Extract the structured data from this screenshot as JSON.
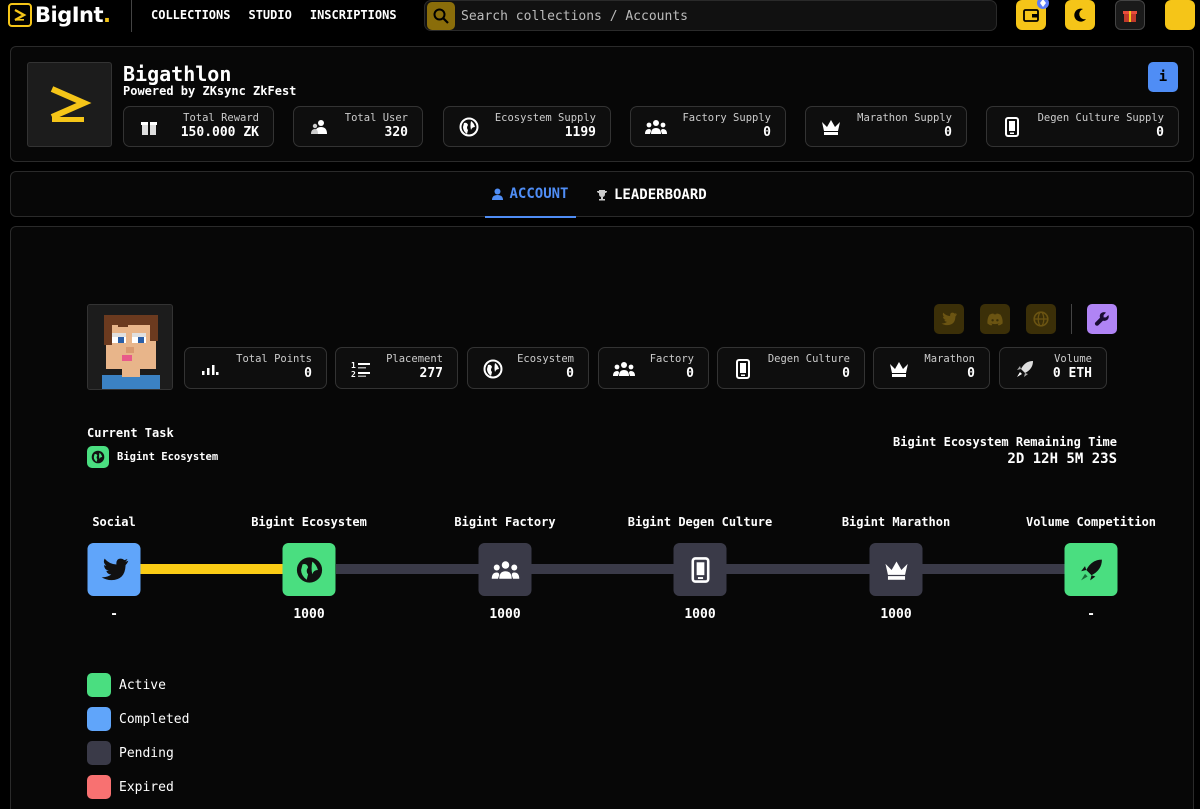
{
  "brand": {
    "name": "BigInt",
    "dot": "."
  },
  "nav": [
    "COLLECTIONS",
    "STUDIO",
    "INSCRIPTIONS"
  ],
  "search": {
    "placeholder": "Search collections / Accounts"
  },
  "header": {
    "title": "Bigathlon",
    "subtitle": "Powered by ZKsync ZkFest",
    "info": "i",
    "stats": [
      {
        "label": "Total Reward",
        "value": "150.000 ZK",
        "icon": "gift-icon"
      },
      {
        "label": "Total User",
        "value": "320",
        "icon": "users-icon"
      },
      {
        "label": "Ecosystem Supply",
        "value": "1199",
        "icon": "globe-icon"
      },
      {
        "label": "Factory Supply",
        "value": "0",
        "icon": "group-icon"
      },
      {
        "label": "Marathon Supply",
        "value": "0",
        "icon": "crown-icon"
      },
      {
        "label": "Degen Culture Supply",
        "value": "0",
        "icon": "phone-icon"
      }
    ]
  },
  "tabs": [
    {
      "label": "ACCOUNT",
      "active": true,
      "icon": "user-icon"
    },
    {
      "label": "LEADERBOARD",
      "active": false,
      "icon": "trophy-icon"
    }
  ],
  "profile": {
    "stats": [
      {
        "label": "Total Points",
        "value": "0",
        "icon": "signal-icon"
      },
      {
        "label": "Placement",
        "value": "277",
        "icon": "ranking-icon"
      },
      {
        "label": "Ecosystem",
        "value": "0",
        "icon": "globe-icon"
      },
      {
        "label": "Factory",
        "value": "0",
        "icon": "group-icon"
      },
      {
        "label": "Degen Culture",
        "value": "0",
        "icon": "phone-icon"
      },
      {
        "label": "Marathon",
        "value": "0",
        "icon": "crown-icon"
      },
      {
        "label": "Volume",
        "value": "0 ETH",
        "icon": "rocket-icon"
      }
    ]
  },
  "current_task": {
    "label": "Current Task",
    "name": "Bigint Ecosystem"
  },
  "remaining": {
    "label": "Bigint Ecosystem Remaining Time",
    "time": "2D 12H 5M 23S"
  },
  "timeline": [
    {
      "label": "Social",
      "value": "-",
      "status": "completed",
      "icon": "twitter-icon"
    },
    {
      "label": "Bigint Ecosystem",
      "value": "1000",
      "status": "active",
      "icon": "globe-icon"
    },
    {
      "label": "Bigint Factory",
      "value": "1000",
      "status": "pending",
      "icon": "group-icon"
    },
    {
      "label": "Bigint Degen Culture",
      "value": "1000",
      "status": "pending",
      "icon": "phone-icon"
    },
    {
      "label": "Bigint Marathon",
      "value": "1000",
      "status": "pending",
      "icon": "crown-icon"
    },
    {
      "label": "Volume Competition",
      "value": "-",
      "status": "active",
      "icon": "rocket-icon"
    }
  ],
  "legend": [
    {
      "label": "Active",
      "color": "#4ade80"
    },
    {
      "label": "Completed",
      "color": "#60a5fa"
    },
    {
      "label": "Pending",
      "color": "#3a3a48"
    },
    {
      "label": "Expired",
      "color": "#f87171"
    }
  ],
  "colors": {
    "accent": "#f5c518",
    "tab_active": "#4f8df5",
    "progress": "#facc15",
    "track": "#3a3a48"
  }
}
